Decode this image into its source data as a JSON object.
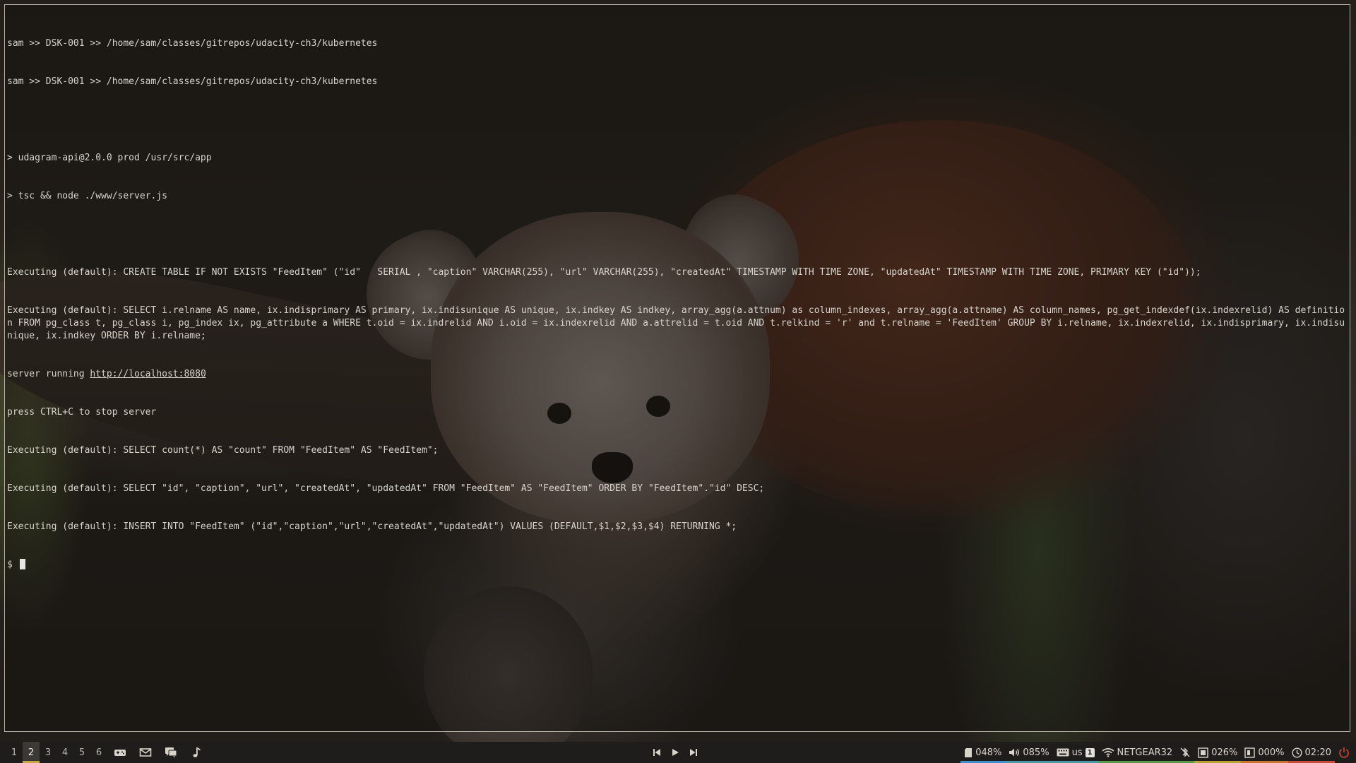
{
  "terminal": {
    "lines": [
      "sam >> DSK-001 >> /home/sam/classes/gitrepos/udacity-ch3/kubernetes",
      "sam >> DSK-001 >> /home/sam/classes/gitrepos/udacity-ch3/kubernetes",
      "",
      "> udagram-api@2.0.0 prod /usr/src/app",
      "> tsc && node ./www/server.js",
      "",
      "Executing (default): CREATE TABLE IF NOT EXISTS \"FeedItem\" (\"id\"   SERIAL , \"caption\" VARCHAR(255), \"url\" VARCHAR(255), \"createdAt\" TIMESTAMP WITH TIME ZONE, \"updatedAt\" TIMESTAMP WITH TIME ZONE, PRIMARY KEY (\"id\"));",
      "Executing (default): SELECT i.relname AS name, ix.indisprimary AS primary, ix.indisunique AS unique, ix.indkey AS indkey, array_agg(a.attnum) as column_indexes, array_agg(a.attname) AS column_names, pg_get_indexdef(ix.indexrelid) AS definition FROM pg_class t, pg_class i, pg_index ix, pg_attribute a WHERE t.oid = ix.indrelid AND i.oid = ix.indexrelid AND a.attrelid = t.oid AND t.relkind = 'r' and t.relname = 'FeedItem' GROUP BY i.relname, ix.indexrelid, ix.indisprimary, ix.indisunique, ix.indkey ORDER BY i.relname;"
    ],
    "server_prefix": "server running ",
    "server_url": "http://localhost:8080",
    "lines_after": [
      "press CTRL+C to stop server",
      "Executing (default): SELECT count(*) AS \"count\" FROM \"FeedItem\" AS \"FeedItem\";",
      "Executing (default): SELECT \"id\", \"caption\", \"url\", \"createdAt\", \"updatedAt\" FROM \"FeedItem\" AS \"FeedItem\" ORDER BY \"FeedItem\".\"id\" DESC;",
      "Executing (default): INSERT INTO \"FeedItem\" (\"id\",\"caption\",\"url\",\"createdAt\",\"updatedAt\") VALUES (DEFAULT,$1,$2,$3,$4) RETURNING *;"
    ],
    "prompt": "$ "
  },
  "statusbar": {
    "workspaces": [
      "1",
      "2",
      "3",
      "4",
      "5",
      "6"
    ],
    "active_workspace": "2",
    "tray_apps": [
      "gamepad-icon",
      "mail-icon",
      "chat-icon",
      "music-note-icon"
    ],
    "media": [
      "previous-track-icon",
      "play-icon",
      "next-track-icon"
    ],
    "indicators": {
      "memory": "048%",
      "volume": "085%",
      "keyboard_layout": "us",
      "keyboard_badge": "1",
      "network": "NETGEAR32",
      "cpu": "026%",
      "disk": "000%",
      "time": "02:20"
    }
  },
  "colors": {
    "terminal_text": "#d8d4cc",
    "bar_bg": "#1e1d1b",
    "accent_blue": "#3e8ed0",
    "accent_red": "#c84a3a"
  }
}
